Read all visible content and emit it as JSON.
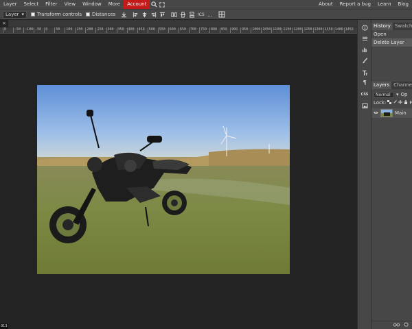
{
  "menu": {
    "left": [
      "Layer",
      "Select",
      "Filter",
      "View",
      "Window",
      "More"
    ],
    "account": "Account",
    "right": [
      "About",
      "Report a bug",
      "Learn",
      "Blog"
    ]
  },
  "toolbar": {
    "select_value": "Layer",
    "transform_controls": "Transform controls",
    "distances": "Distances",
    "ics_label": "ICS",
    "more_label": "..."
  },
  "tab": {
    "label": "×"
  },
  "ruler": {
    "ticks": [
      "0",
      "-50",
      "-100",
      "-50",
      "0",
      "50",
      "100",
      "150",
      "200",
      "250",
      "300",
      "350",
      "400",
      "450",
      "500",
      "550",
      "600",
      "650",
      "700",
      "750",
      "800",
      "850",
      "900",
      "950",
      "1000",
      "1050",
      "1100",
      "1150",
      "1200",
      "1250",
      "1300",
      "1350",
      "1400",
      "1450"
    ]
  },
  "rightcol": {
    "css_label": "CSS"
  },
  "history": {
    "tabs": [
      "History",
      "Swatches"
    ],
    "items": [
      "Open",
      "Delete Layer"
    ]
  },
  "layers": {
    "tabs": [
      "Layers",
      "Channels"
    ],
    "blend_mode": "Normal",
    "opacity_label": "Op",
    "lock_label": "Lock:",
    "fill_label": "F",
    "layer_name": "Main"
  },
  "status": {
    "zoom": "913"
  },
  "colors": {
    "accent": "#c41a1a",
    "chrome": "#474747",
    "canvas_bg": "#232323"
  }
}
